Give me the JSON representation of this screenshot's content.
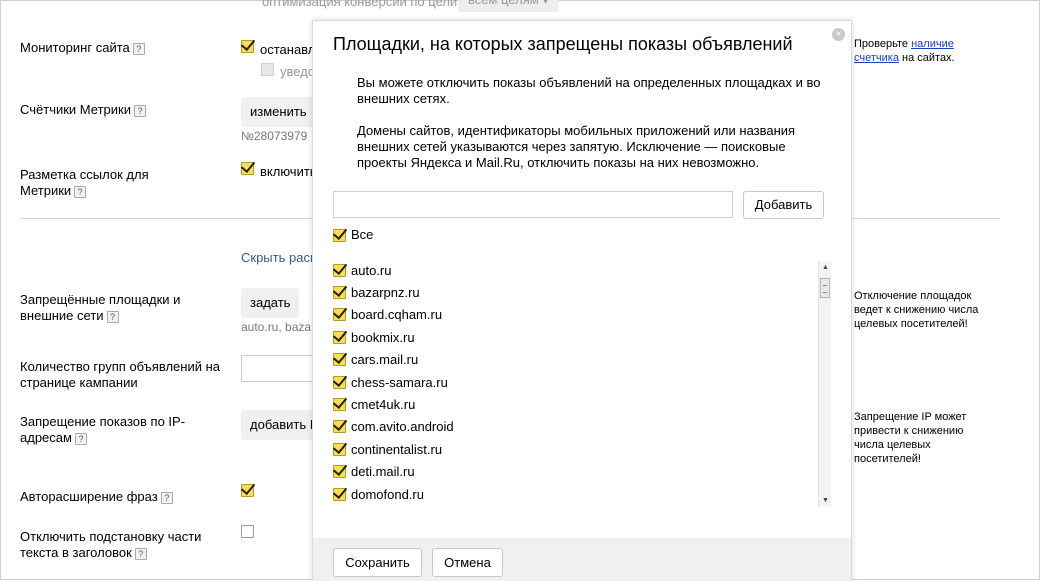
{
  "top_partial": {
    "text": "оптимизация конверсии по цели",
    "button": "всем целям ▾"
  },
  "settings": {
    "monitoring": {
      "label": "Мониторинг сайта",
      "hint": "?",
      "option1": "останавл",
      "option2": "уведо"
    },
    "counters": {
      "label": "Счётчики Метрики",
      "hint": "?",
      "button": "изменить",
      "number": "№28073979"
    },
    "markup": {
      "label": "Разметка ссылок для Метрики",
      "hint": "?",
      "option": "включить"
    },
    "hide_link": "Скрыть расш",
    "banned": {
      "label": "Запрещённые площадки и внешние сети",
      "hint": "?",
      "button": "задать",
      "value": "auto.ru, baza"
    },
    "groups_count": {
      "label": "Количество групп объявлений на странице кампании"
    },
    "ip_ban": {
      "label": "Запрещение показов по IP-адресам",
      "hint": "?",
      "button": "добавить I"
    },
    "autoexpand": {
      "label": "Авторасширение фраз",
      "hint": "?"
    },
    "substitution": {
      "label": "Отключить подстановку части текста в заголовок",
      "hint": "?"
    }
  },
  "right_notes": {
    "counter_note_pre": "Проверьте",
    "counter_note_link": "наличие счетчика",
    "counter_note_post": "на сайтах.",
    "banned_note": "Отключение площадок ведет к снижению числа целевых посетителей!",
    "ip_note": "Запрещение IP может привести к снижению числа целевых посетителей!"
  },
  "modal": {
    "title": "Площадки, на которых запрещены показы объявлений",
    "close": "×",
    "paragraph1": "Вы можете отключить показы объявлений на определенных площадках и во внешних сетях.",
    "paragraph2": "Домены сайтов, идентификаторы мобильных приложений или названия внешних сетей указываются через запятую. Исключение — поисковые проекты Яндекса и Mail.Ru, отключить показы на них невозможно.",
    "input_value": "",
    "add_button": "Добавить",
    "all_label": "Все",
    "sites": [
      "auto.ru",
      "bazarpnz.ru",
      "board.cqham.ru",
      "bookmix.ru",
      "cars.mail.ru",
      "chess-samara.ru",
      "cmet4uk.ru",
      "com.avito.android",
      "continentalist.ru",
      "deti.mail.ru",
      "domofond.ru"
    ],
    "save_button": "Сохранить",
    "cancel_button": "Отмена"
  }
}
